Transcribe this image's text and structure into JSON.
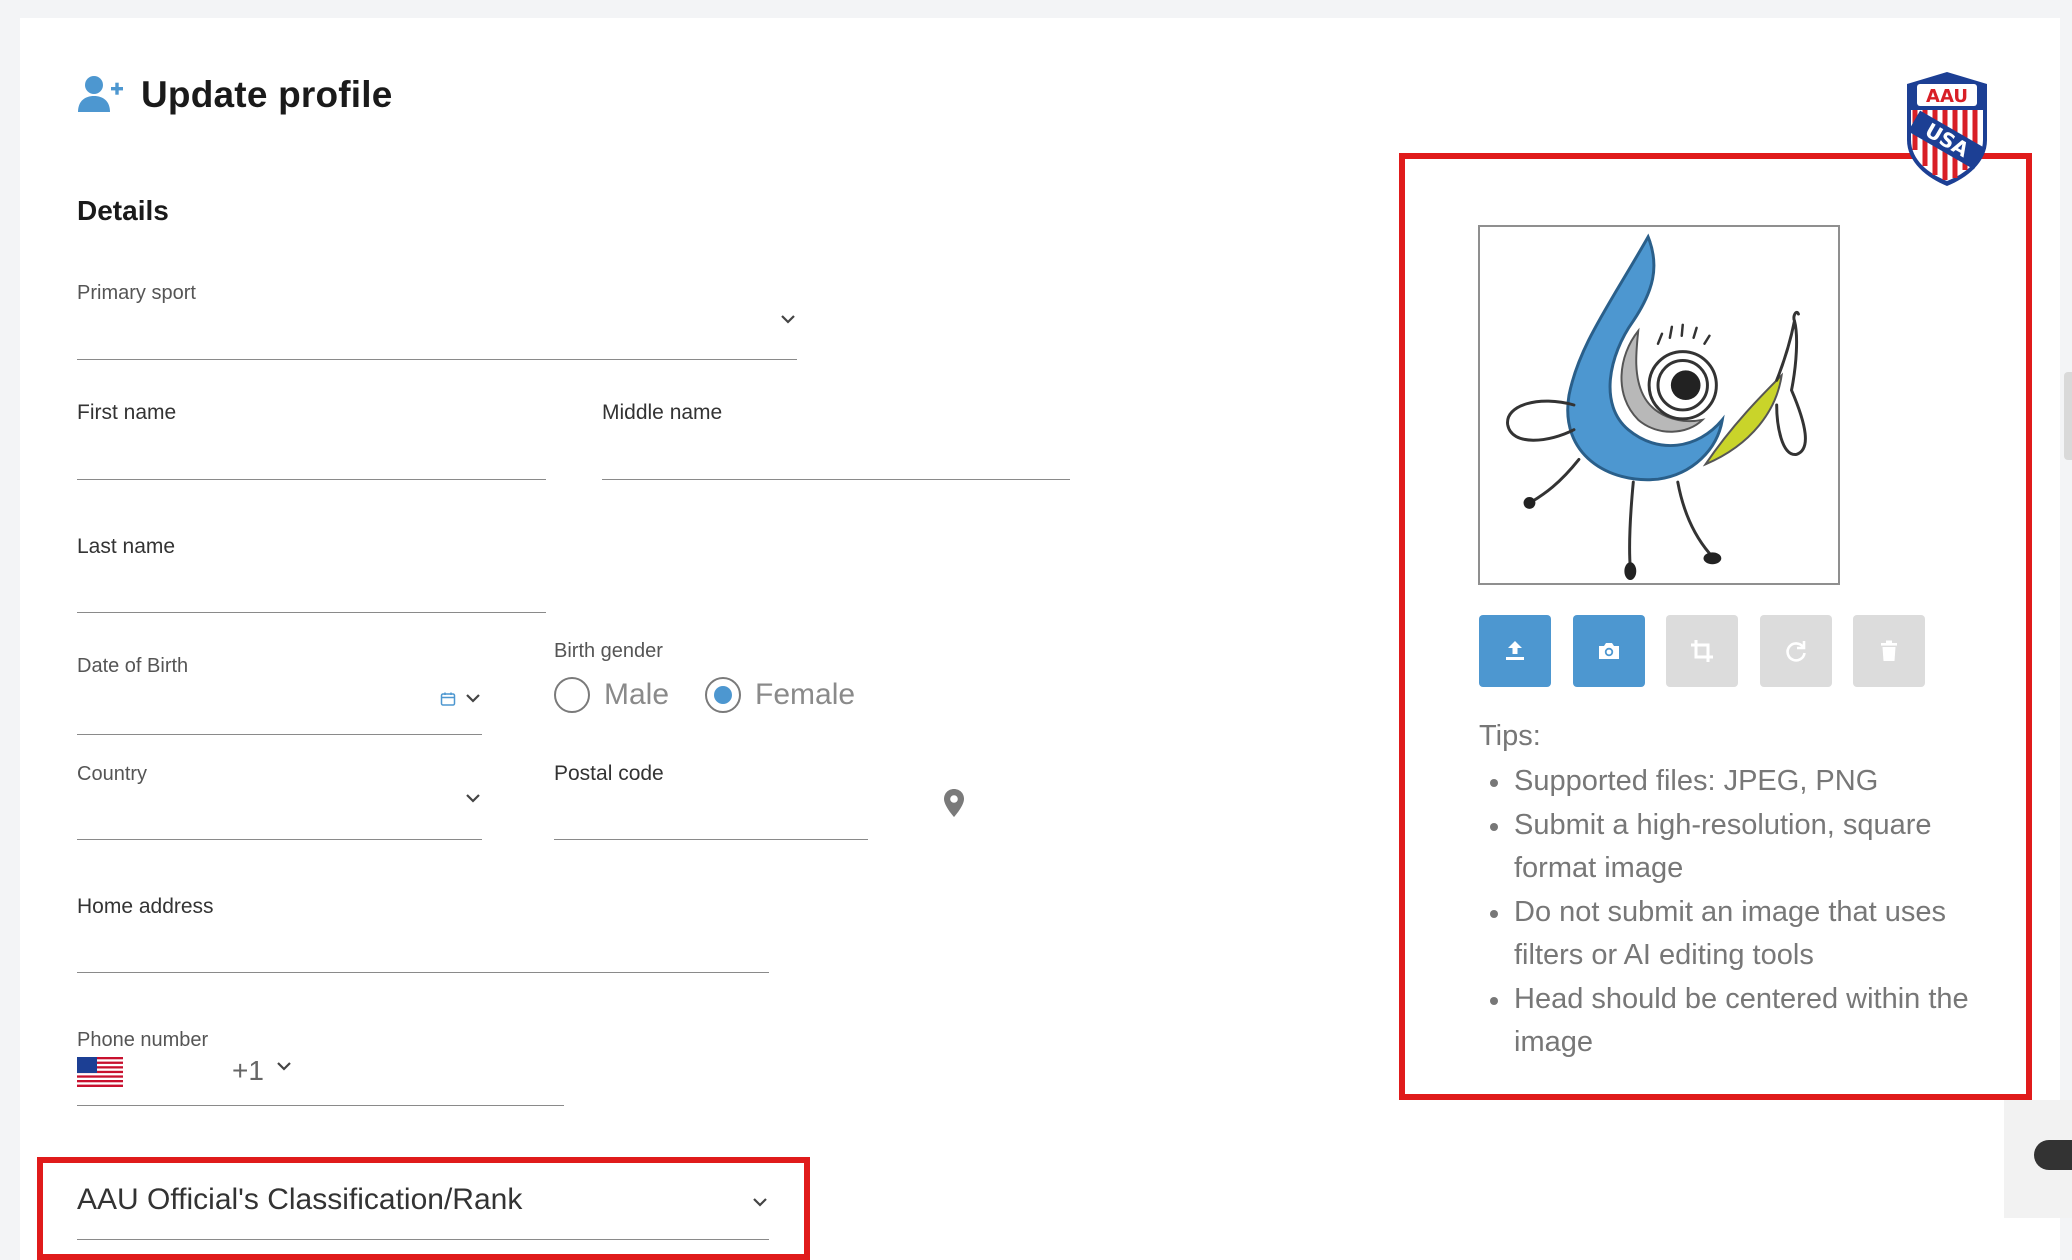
{
  "header": {
    "title": "Update profile",
    "icon": "user-plus-icon"
  },
  "details": {
    "section_title": "Details",
    "primary_sport": {
      "label": "Primary sport",
      "value": ""
    },
    "first_name": {
      "label": "First name",
      "value": ""
    },
    "middle_name": {
      "label": "Middle name",
      "value": ""
    },
    "last_name": {
      "label": "Last name",
      "value": ""
    },
    "date_of_birth": {
      "label": "Date of Birth",
      "value": ""
    },
    "birth_gender": {
      "label": "Birth gender",
      "options": [
        "Male",
        "Female"
      ],
      "selected": "Female"
    },
    "country": {
      "label": "Country",
      "value": ""
    },
    "postal_code": {
      "label": "Postal code",
      "value": ""
    },
    "home_address": {
      "label": "Home address",
      "value": ""
    },
    "phone": {
      "label": "Phone number",
      "country_code": "+1",
      "value": ""
    },
    "classification": {
      "label": "AAU Official's Classification/Rank"
    }
  },
  "photo": {
    "tools": [
      "upload-icon",
      "camera-icon",
      "crop-icon",
      "rotate-icon",
      "trash-icon"
    ],
    "tips_title": "Tips:",
    "tips": [
      "Supported files: JPEG, PNG",
      "Submit a high-resolution, square format image",
      "Do not submit an image that uses filters or AI editing tools",
      "Head should be centered within the image"
    ]
  },
  "logo": {
    "top_text": "AAU",
    "bottom_text": "USA"
  },
  "colors": {
    "accent": "#4d97d0",
    "highlight": "#e01b1b",
    "disabled": "#dcdcdc"
  }
}
